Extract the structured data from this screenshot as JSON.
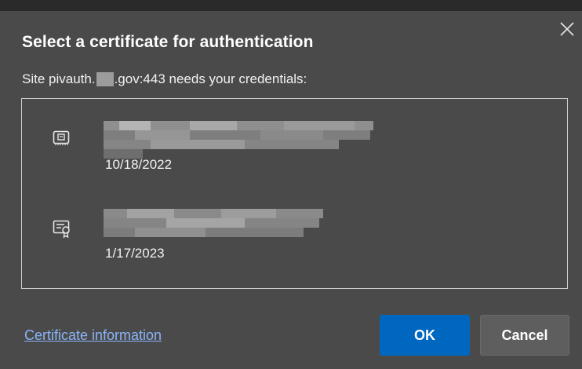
{
  "dialog": {
    "title": "Select a certificate for authentication",
    "site_prefix": "Site pivauth.",
    "site_suffix": ".gov:443 needs your credentials:",
    "close_icon": "close-icon"
  },
  "certificates": [
    {
      "icon": "smartcard-chip-icon",
      "date": "10/18/2022"
    },
    {
      "icon": "certificate-ribbon-icon",
      "date": "1/17/2023"
    }
  ],
  "footer": {
    "link_label": "Certificate information",
    "ok_label": "OK",
    "cancel_label": "Cancel"
  },
  "colors": {
    "background": "#4a4a4a",
    "topbar": "#2a2a2a",
    "primary_button": "#0067c0",
    "secondary_button": "#5e5e5e",
    "link": "#8ab4f8",
    "redaction": "#9c9c9c"
  }
}
